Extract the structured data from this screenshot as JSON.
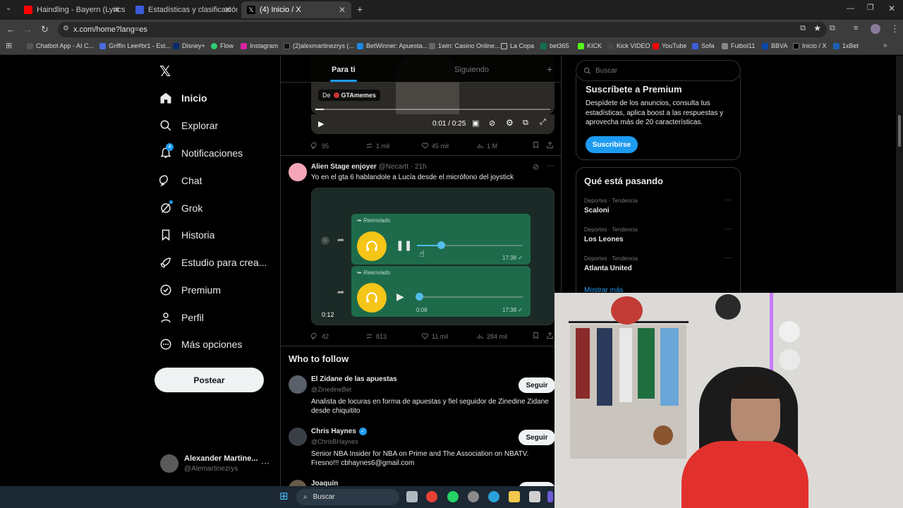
{
  "browser": {
    "tabs": [
      {
        "title": "Haindling - Bayern (Lyrics) - Yo",
        "active": false
      },
      {
        "title": "Estadísticas y clasificación de C",
        "active": false
      },
      {
        "title": "(4) Inicio / X",
        "active": true
      }
    ],
    "url": "x.com/home?lang=es",
    "bookmarks": [
      "Chatbot App - AI C...",
      "Griffin Lee#br1 - Est...",
      "Disney+",
      "Flow",
      "Instagram",
      "(2)alexmartinezrys (...",
      "BetWinner: Apuesta...",
      "1win: Casino Online...",
      "La Copa",
      "bet365",
      "KICK",
      "Kick VIDEO",
      "YouTube",
      "Sofa",
      "Futbol11",
      "BBVA",
      "Inicio / X",
      "1xBet"
    ]
  },
  "sidebar": {
    "items": [
      {
        "label": "Inicio",
        "icon": "home-icon"
      },
      {
        "label": "Explorar",
        "icon": "search-icon"
      },
      {
        "label": "Notificaciones",
        "icon": "bell-icon",
        "badge": "4"
      },
      {
        "label": "Chat",
        "icon": "chat-icon"
      },
      {
        "label": "Grok",
        "icon": "grok-icon"
      },
      {
        "label": "Historia",
        "icon": "bookmark-icon"
      },
      {
        "label": "Estudio para crea...",
        "icon": "rocket-icon"
      },
      {
        "label": "Premium",
        "icon": "verified-icon"
      },
      {
        "label": "Perfil",
        "icon": "person-icon"
      },
      {
        "label": "Más opciones",
        "icon": "more-circle-icon"
      }
    ],
    "post_button": "Postear",
    "account": {
      "name": "Alexander Martine...",
      "handle": "@Alemartinezrys"
    }
  },
  "feed": {
    "tabs": {
      "for_you": "Para ti",
      "following": "Siguiendo"
    },
    "video_post": {
      "source_prefix": "De",
      "source": "GTAmemes",
      "time": "0:01 / 0:25",
      "stats": {
        "replies": "95",
        "reposts": "1 mil",
        "likes": "45 mil",
        "views": "1 M"
      }
    },
    "post": {
      "author": "Alien Stage enjoyer",
      "handle": "@Necartt",
      "age": "21h",
      "text": "Yo en el gta 6 hablandole a Lucía desde el micrófono del joystick",
      "forwarded": "Reenviado",
      "msg1_time": "17:38",
      "msg2_duration": "0:08",
      "msg2_time": "17:38",
      "video_duration": "0:12",
      "stats": {
        "replies": "42",
        "reposts": "813",
        "likes": "11 mil",
        "views": "284 mil"
      }
    },
    "who_to_follow": {
      "title": "Who to follow",
      "follow_label": "Seguir",
      "accounts": [
        {
          "name": "El Zidane de las apuestas",
          "handle": "@ZinedineBet",
          "bio": "Analista de locuras en forma de apuestas y fiel seguidor de Zinedine Zidane desde chiquitito",
          "verified": false
        },
        {
          "name": "Chris Haynes",
          "handle": "@ChrisBHaynes",
          "bio": "Senior NBA Insider for NBA on Prime and The Association on NBATV. Fresno!!! cbhaynes6@gmail.com",
          "verified": true
        },
        {
          "name": "Joaquín",
          "handle": "",
          "bio": "",
          "verified": false
        }
      ]
    }
  },
  "right": {
    "search_placeholder": "Buscar",
    "premium": {
      "title": "Suscríbete a Premium",
      "text": "Despídete de los anuncios, consulta tus estadísticas, aplica boost a las respuestas y aprovecha más de 20 características.",
      "button": "Suscribirse"
    },
    "trends": {
      "title": "Qué está pasando",
      "items": [
        {
          "context": "Deportes · Tendencia",
          "name": "Scaloni"
        },
        {
          "context": "Deportes · Tendencia",
          "name": "Los Leones"
        },
        {
          "context": "Deportes · Tendencia",
          "name": "Atlanta United"
        }
      ],
      "show_more": "Mostrar más"
    }
  },
  "taskbar": {
    "search": "Buscar"
  },
  "colors": {
    "accent": "#1d9bf0",
    "whatsapp_bubble": "#1e6b4b",
    "headphone": "#f5c518"
  }
}
